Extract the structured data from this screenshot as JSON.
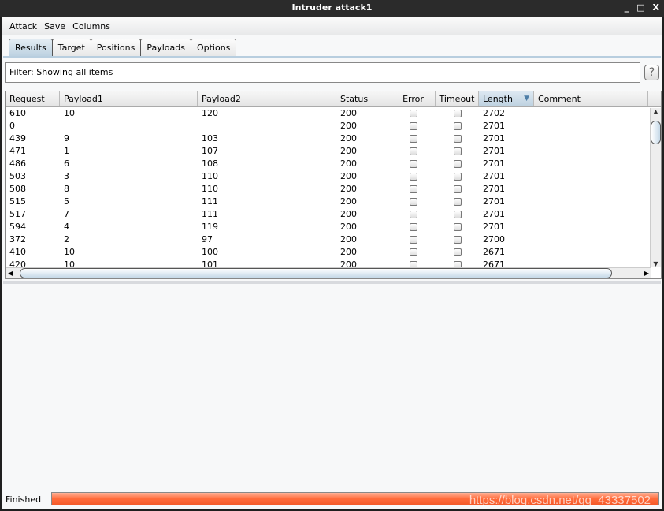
{
  "window": {
    "title": "Intruder attack1",
    "controls": [
      "_",
      "□",
      "X"
    ]
  },
  "menu": [
    "Attack",
    "Save",
    "Columns"
  ],
  "tabs": [
    "Results",
    "Target",
    "Positions",
    "Payloads",
    "Options"
  ],
  "filter": {
    "text": "Filter:  Showing all items",
    "help": "?"
  },
  "table": {
    "columns": [
      "Request",
      "Payload1",
      "Payload2",
      "Status",
      "Error",
      "Timeout",
      "Length",
      "Comment"
    ],
    "sorted_column": "Length",
    "rows": [
      [
        "610",
        "10",
        "120",
        "200",
        false,
        false,
        "2702",
        ""
      ],
      [
        "0",
        "",
        "",
        "200",
        false,
        false,
        "2701",
        ""
      ],
      [
        "439",
        "9",
        "103",
        "200",
        false,
        false,
        "2701",
        ""
      ],
      [
        "471",
        "1",
        "107",
        "200",
        false,
        false,
        "2701",
        ""
      ],
      [
        "486",
        "6",
        "108",
        "200",
        false,
        false,
        "2701",
        ""
      ],
      [
        "503",
        "3",
        "110",
        "200",
        false,
        false,
        "2701",
        ""
      ],
      [
        "508",
        "8",
        "110",
        "200",
        false,
        false,
        "2701",
        ""
      ],
      [
        "515",
        "5",
        "111",
        "200",
        false,
        false,
        "2701",
        ""
      ],
      [
        "517",
        "7",
        "111",
        "200",
        false,
        false,
        "2701",
        ""
      ],
      [
        "594",
        "4",
        "119",
        "200",
        false,
        false,
        "2701",
        ""
      ],
      [
        "372",
        "2",
        "97",
        "200",
        false,
        false,
        "2700",
        ""
      ],
      [
        "410",
        "10",
        "100",
        "200",
        false,
        false,
        "2671",
        ""
      ],
      [
        "420",
        "10",
        "101",
        "200",
        false,
        false,
        "2671",
        ""
      ]
    ]
  },
  "status": {
    "label": "Finished",
    "progress_percent": 100,
    "color": "#ff6b3a"
  },
  "watermark": "https://blog.csdn.net/qq_43337502"
}
